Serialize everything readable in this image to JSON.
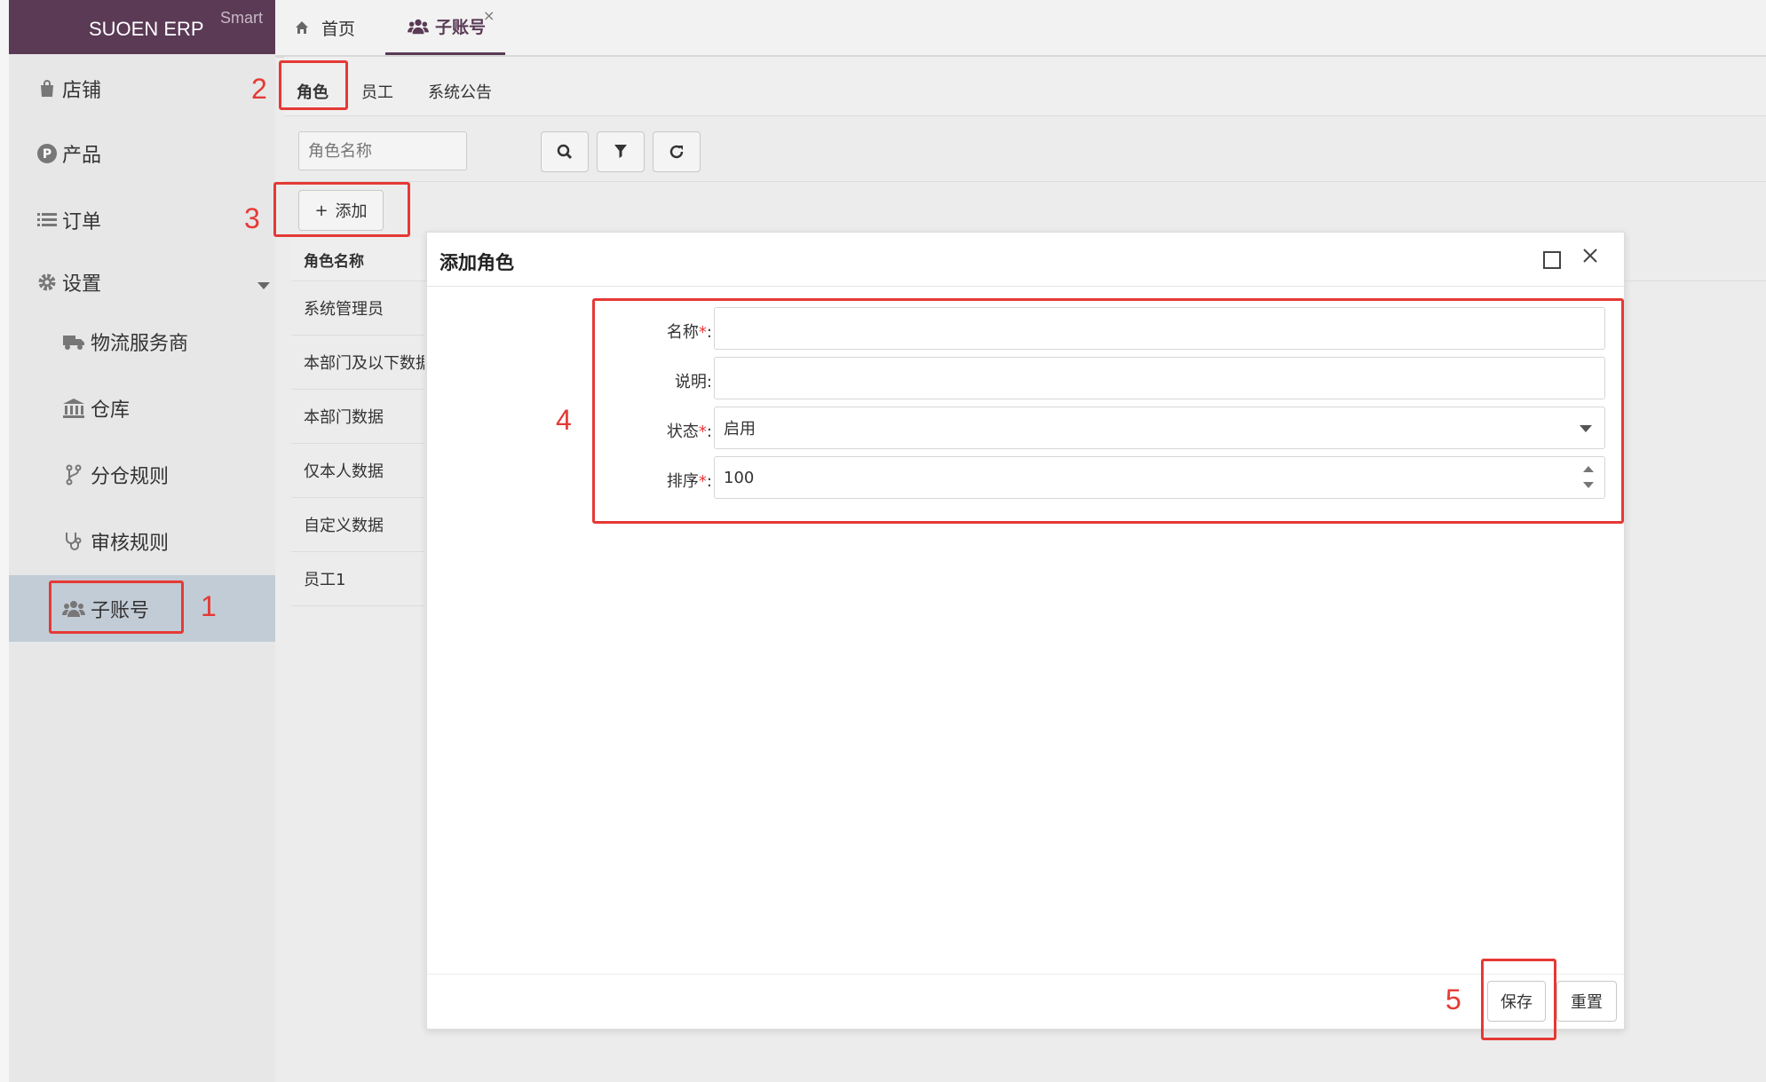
{
  "brand": {
    "title": "SUOEN ERP",
    "sub": "Smart"
  },
  "sidebar": {
    "items": [
      {
        "label": "店铺",
        "icon": "shopping-bag-icon"
      },
      {
        "label": "产品",
        "icon": "p-circle-icon"
      },
      {
        "label": "订单",
        "icon": "list-icon"
      },
      {
        "label": "设置",
        "icon": "gear-icon"
      },
      {
        "label": "物流服务商",
        "icon": "truck-icon"
      },
      {
        "label": "仓库",
        "icon": "bank-icon"
      },
      {
        "label": "分仓规则",
        "icon": "code-fork-icon"
      },
      {
        "label": "审核规则",
        "icon": "stethoscope-icon"
      },
      {
        "label": "子账号",
        "icon": "users-icon"
      }
    ]
  },
  "header": {
    "tabs": [
      {
        "label": "首页",
        "icon": "home-icon"
      },
      {
        "label": "子账号",
        "icon": "users-icon"
      }
    ],
    "close_symbol": "×"
  },
  "subtabs": [
    "角色",
    "员工",
    "系统公告"
  ],
  "toolbar": {
    "search_placeholder": "角色名称",
    "add_label": "添加",
    "add_symbol": "+"
  },
  "table": {
    "header": "角色名称",
    "rows": [
      "系统管理员",
      "本部门及以下数据",
      "本部门数据",
      "仅本人数据",
      "自定义数据",
      "员工1"
    ]
  },
  "dialog": {
    "title": "添加角色",
    "fields": [
      {
        "label": "名称",
        "required": "*",
        "colon": ":",
        "value": ""
      },
      {
        "label": "说明",
        "required": "",
        "colon": ":",
        "value": ""
      },
      {
        "label": "状态",
        "required": "*",
        "colon": ":",
        "value": "启用"
      },
      {
        "label": "排序",
        "required": "*",
        "colon": ":",
        "value": "100"
      }
    ],
    "save_label": "保存",
    "reset_label": "重置"
  },
  "annotations": [
    "1",
    "2",
    "3",
    "4",
    "5"
  ],
  "colors": {
    "brand": "#5a3a55",
    "annotation": "#e53935",
    "active_menu": "#c2ccd6"
  }
}
